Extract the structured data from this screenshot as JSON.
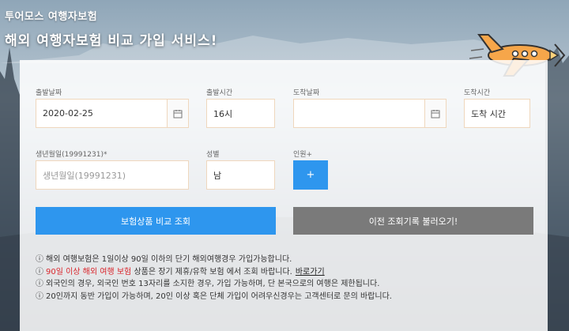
{
  "header": {
    "sub_title": "투어모스 여행자보험",
    "main_title": "해외 여행자보험 비교 가입 서비스!"
  },
  "form": {
    "depart_date": {
      "label": "출발날짜",
      "value": "2020-02-25"
    },
    "depart_time": {
      "label": "출발시간",
      "value": "16시"
    },
    "arrive_date": {
      "label": "도착날짜",
      "value": ""
    },
    "arrive_time": {
      "label": "도착시간",
      "value": "도착 시간"
    },
    "birth": {
      "label": "생년월일(19991231)*",
      "placeholder": "생년월일(19991231)"
    },
    "gender": {
      "label": "성별",
      "value": "남"
    },
    "people": {
      "label": "인원+",
      "button": "+"
    }
  },
  "buttons": {
    "compare": "보험상품 비교 조회",
    "history": "이전 조회기록 불러오기!"
  },
  "notes": {
    "n1": "해외 여행보험은 1일이상 90일 이하의 단기 해외여행경우 가입가능합니다.",
    "n2_red": "90일 이상 해외 여행 보험",
    "n2_rest": "상품은 장기 제휴/유학 보험 에서 조회 바랍니다.",
    "n2_link": "바로가기",
    "n3": "외국인의 경우, 외국인 번호 13자리를 소지한 경우, 가입 가능하며, 단 본국으로의 여행은 제한됩니다.",
    "n4": "20인까지 동반 가입이 가능하며, 20인 이상 혹은 단체 가입이 어려우신경우는 고객센터로 문의 바랍니다."
  },
  "icons": {
    "calendar": "calendar-icon",
    "info": "info-circle-icon",
    "plane": "airplane-icon"
  },
  "colors": {
    "primary_blue": "#2e96ee",
    "gray_button": "#7a7a7a",
    "warning_red": "#d9262c",
    "field_border": "#efd7bd"
  }
}
